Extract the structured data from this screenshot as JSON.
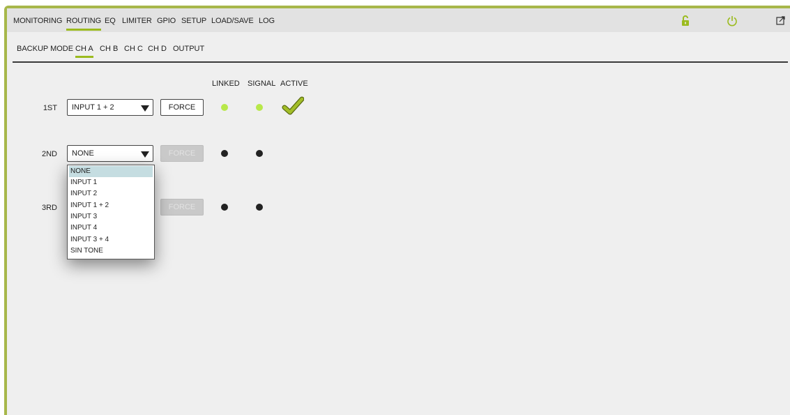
{
  "nav": {
    "items": [
      "MONITORING",
      "ROUTING",
      "EQ",
      "LIMITER",
      "GPIO",
      "SETUP",
      "LOAD/SAVE",
      "LOG"
    ],
    "active": "ROUTING"
  },
  "toolbar": {
    "lock_icon": "unlocked-padlock",
    "power_icon": "power",
    "expand_icon": "expand-window",
    "accent": "#9bbb1e"
  },
  "subnav": {
    "items": [
      "BACKUP MODE",
      "CH A",
      "CH B",
      "CH C",
      "CH D",
      "OUTPUT"
    ],
    "active": "CH A"
  },
  "columns": {
    "linked": "LINKED",
    "signal": "SIGNAL",
    "active": "ACTIVE"
  },
  "rows": [
    {
      "label": "1ST",
      "source": "INPUT 1 + 2",
      "force": "FORCE",
      "force_enabled": true,
      "linked": true,
      "signal": true,
      "active": true
    },
    {
      "label": "2ND",
      "source": "NONE",
      "force": "FORCE",
      "force_enabled": false,
      "linked": false,
      "signal": false,
      "active": false
    },
    {
      "label": "3RD",
      "source": "",
      "force": "FORCE",
      "force_enabled": false,
      "linked": false,
      "signal": false,
      "active": false
    }
  ],
  "dropdown": {
    "options": [
      "NONE",
      "INPUT 1",
      "INPUT 2",
      "INPUT 1 + 2",
      "INPUT 3",
      "INPUT 4",
      "INPUT 3 + 4",
      "SIN TONE"
    ],
    "selected": "NONE"
  }
}
